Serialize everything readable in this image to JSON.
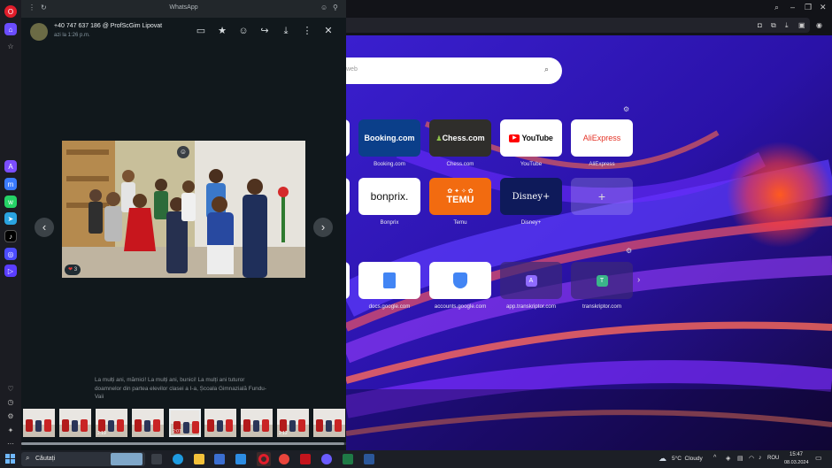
{
  "whatsapp": {
    "tab_title": "WhatsApp",
    "sender": "+40 747 637 186 @ ProfScGim Lipovat",
    "timestamp": "azi la 1:26 p.m.",
    "reaction_count": "3",
    "caption": "La mulți ani, mămici! La mulți ani, bunici! La mulți ani tuturor doamnelor din partea elevilor clasei a I-a, Școala Gimnazială Fundu-Vaii",
    "thumbnail_labels": [
      "",
      "",
      "2:19",
      "",
      "2:07",
      "",
      "",
      "2:12",
      ""
    ]
  },
  "newtab": {
    "search_placeholder": "web",
    "row1": [
      {
        "logo": "Booking.com",
        "label": "Booking.com"
      },
      {
        "logo": "Chess.com",
        "label": "Chess.com"
      },
      {
        "logo": "YouTube",
        "label": "YouTube"
      },
      {
        "logo": "AliExpress",
        "label": "AliExpress"
      }
    ],
    "row2": [
      {
        "logo": "bonprix.",
        "label": "Bonprix"
      },
      {
        "logo": "TEMU",
        "label": "Temu"
      },
      {
        "logo": "Disney+",
        "label": "Disney+"
      },
      {
        "logo": "+",
        "label": ""
      }
    ],
    "row3": [
      {
        "label": "docs.google.com"
      },
      {
        "label": "accounts.google.com"
      },
      {
        "logo": "A",
        "label": "app.transkriptor.com"
      },
      {
        "logo": "T",
        "label": "transkriptor.com"
      }
    ]
  },
  "taskbar": {
    "search_label": "Căutați",
    "weather": "5°C  Cloudy",
    "language": "ROU",
    "time": "15:47",
    "date": "08.03.2024"
  },
  "colors": {
    "whatsapp_bg": "#11181c",
    "booking": "#0b3f8a",
    "chess": "#2f2e2b",
    "temu": "#f26b10",
    "disney": "#0e1a5a",
    "wallpaper_purple": "#3b1fd0",
    "wallpaper_orange": "#ff5a1f"
  }
}
